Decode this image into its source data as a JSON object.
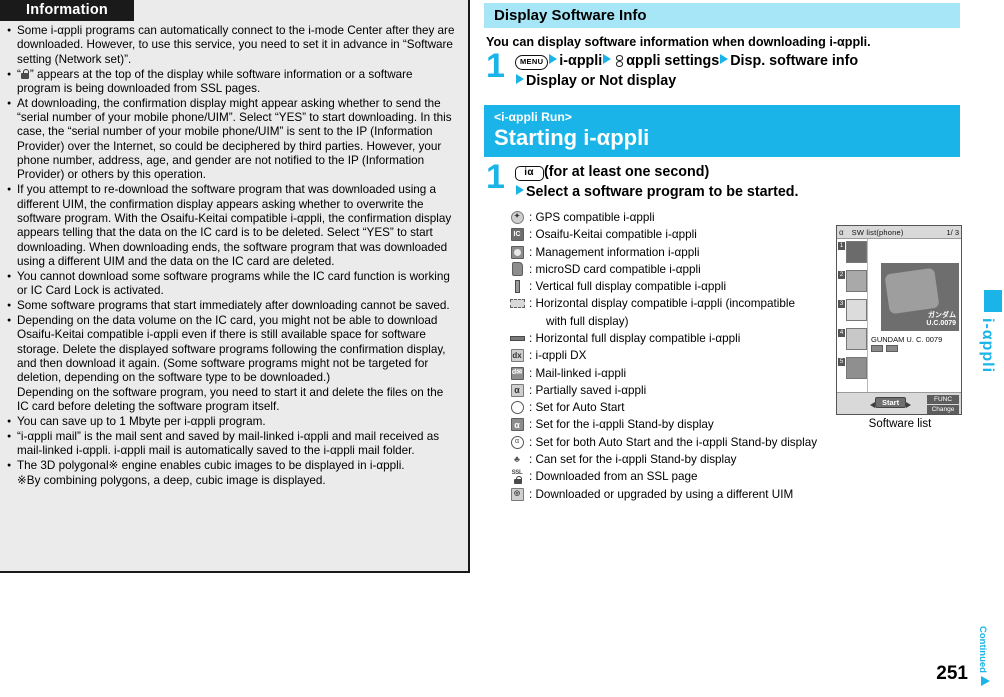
{
  "left": {
    "header": "Information",
    "bullets": [
      {
        "text": "Some i-αppli programs can automatically connect to the i-mode Center after they are downloaded. However, to use this service, you need to set it in advance in “Software setting (Network set)”."
      },
      {
        "text": "“ ” appears at the top of the display while software information or a software program is being downloaded from SSL pages.",
        "has_lock_icon": true,
        "prefix": "“",
        "suffix": "” appears at the top of the display while software information or a software program is being downloaded from SSL pages."
      },
      {
        "text": "At downloading, the confirmation display might appear asking whether to send the “serial number of your mobile phone/UIM”. Select “YES” to start downloading. In this case, the “serial number of your mobile phone/UIM” is sent to the IP (Information Provider) over the Internet, so could be deciphered by third parties. However, your phone number, address, age, and gender are not notified to the IP (Information Provider) or others by this operation."
      },
      {
        "text": "If you attempt to re-download the software program that was downloaded using a different UIM, the confirmation display appears asking whether to overwrite the software program. With the Osaifu-Keitai compatible i-αppli, the confirmation display appears telling that the data on the IC card is to be deleted. Select “YES” to start downloading. When downloading ends, the software program that was downloaded using a different UIM and the data on the IC card are deleted."
      },
      {
        "text": "You cannot download some software programs while the IC card function is working or IC Card Lock is activated."
      },
      {
        "text": "Some software programs that start immediately after downloading cannot be saved."
      },
      {
        "text": "Depending on the data volume on the IC card, you might not be able to download Osaifu-Keitai compatible i-αppli even if there is still available space for software storage. Delete the displayed software programs following the confirmation display, and then download it again. (Some software programs might not be targeted for deletion, depending on the software type to be downloaded.)"
      },
      {
        "text": "Depending on the software program, you need to start it and delete the files on the IC card before deleting the software program itself.",
        "nobullet": true
      },
      {
        "text": "You can save up to 1 Mbyte per i-αppli program."
      },
      {
        "text": "“i-αppli mail” is the mail sent and saved by mail-linked i-αppli and mail received as mail-linked i-αppli. i-αppli mail is automatically saved to the i-αppli mail folder."
      },
      {
        "text": "The 3D polygonal※ engine enables cubic images to be displayed in i-αppli."
      },
      {
        "text": "※By combining polygons, a deep, cubic image is displayed.",
        "nobullet": true
      }
    ]
  },
  "right": {
    "section1": {
      "title": "Display Software Info",
      "lead": "You can display software information when downloading i-αppli.",
      "step_number": "1",
      "step_line1_parts": {
        "key": "MENU",
        "item1": "i-αppli",
        "item2": "αppli settings",
        "item3": "Disp. software info"
      },
      "step_line2": "Display or Not display"
    },
    "section2": {
      "kicker": "<i-αppli Run>",
      "title": "Starting i-αppli",
      "step_number": "1",
      "step_key": "iα",
      "step_line1_tail": "(for at least one second)",
      "step_line2": "Select a software program to be started."
    },
    "legend": [
      {
        "icon": "gps-icon",
        "text": ": GPS compatible i-αppli"
      },
      {
        "icon": "ic-card-icon",
        "text": ": Osaifu-Keitai compatible i-αppli"
      },
      {
        "icon": "management-info-icon",
        "text": ": Management information i-αppli"
      },
      {
        "icon": "microsd-icon",
        "text": ": microSD card compatible i-αppli"
      },
      {
        "icon": "vertical-full-display-icon",
        "text": ": Vertical full display compatible i-αppli"
      },
      {
        "icon": "horizontal-display-icon",
        "text": ": Horizontal display compatible i-αppli (incompatible",
        "continuation": "with full display)"
      },
      {
        "icon": "horizontal-full-display-icon",
        "text": ": Horizontal full display compatible i-αppli"
      },
      {
        "icon": "dx-icon",
        "text": ": i-αppli DX"
      },
      {
        "icon": "mail-linked-icon",
        "text": ": Mail-linked i-αppli"
      },
      {
        "icon": "partially-saved-icon",
        "text": ": Partially saved i-αppli"
      },
      {
        "icon": "auto-start-icon",
        "text": ": Set for Auto Start"
      },
      {
        "icon": "standby-display-icon",
        "text": ": Set for the i-αppli Stand-by display"
      },
      {
        "icon": "auto-start-and-standby-icon",
        "text": ": Set for both Auto Start and the i-αppli Stand-by display"
      },
      {
        "icon": "can-set-standby-icon",
        "text": ": Can set for the i-αppli Stand-by display"
      },
      {
        "icon": "ssl-page-icon",
        "text": ": Downloaded from an SSL page"
      },
      {
        "icon": "different-uim-icon",
        "text": ": Downloaded or upgraded by using a different UIM"
      }
    ],
    "screenshot": {
      "status_icon": "partially-saved-icon",
      "status_title": "SW list(phone)",
      "page_indicator": "1/ 3",
      "list_indices": [
        "1",
        "2",
        "3",
        "4",
        "5"
      ],
      "hero_logo_line1": "ガンダム",
      "hero_logo_line2": "U.C.0079",
      "caption": "GUNDAM U. C. 0079",
      "softkey_center": "Start",
      "softkey_right_top": "FUNC",
      "softkey_right_bottom": "Change",
      "label": "Software list"
    }
  },
  "footer": {
    "side_tab_label": "i-αppli",
    "page_number": "251",
    "continued_label": "Continued"
  },
  "colors": {
    "accent_cyan": "#1ab4e8",
    "title_band": "#a7e6f7",
    "info_header_bg": "#1a1a1a",
    "left_panel_bg": "#ebebeb"
  }
}
